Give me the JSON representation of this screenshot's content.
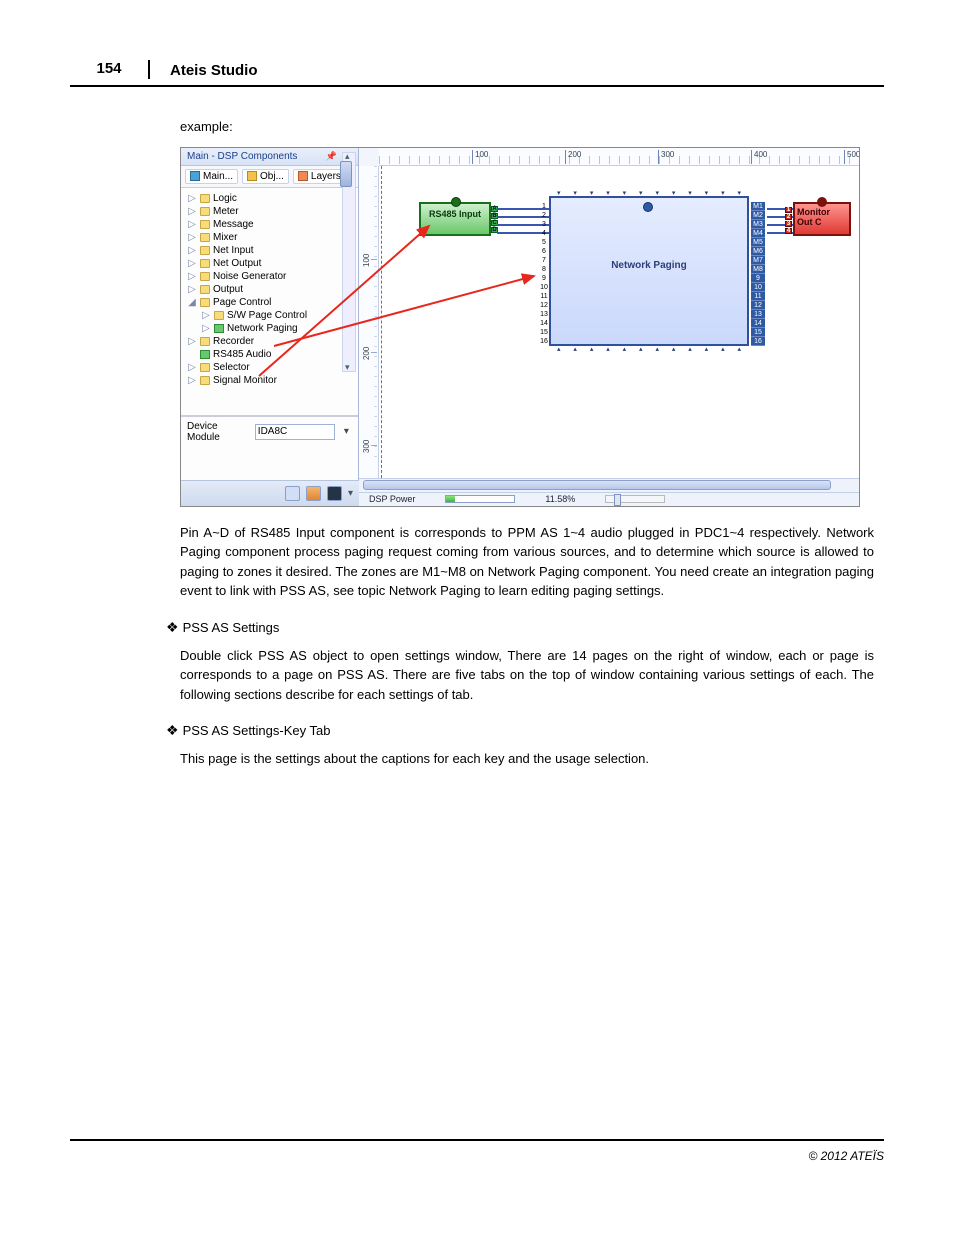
{
  "page": {
    "number": "154",
    "title": "Ateis Studio"
  },
  "text": {
    "example": "example:",
    "para1": "Pin A~D of RS485 Input component is corresponds to PPM AS 1~4 audio plugged in PDC1~4 respectively. Network Paging component process paging request coming from various sources, and to determine which source is allowed to paging to zones it desired. The zones are M1~M8 on Network Paging component. You need create an integration paging event to link with PSS AS, see topic Network Paging to learn editing paging settings.",
    "h1": "PSS AS Settings",
    "para2": "Double click PSS AS object to open settings window, There are 14 pages on the right of window, each or page is corresponds to a page on PSS AS.  There are five tabs on the top of window containing various settings of each. The following sections describe for each settings of tab.",
    "h2": "PSS AS Settings-Key Tab",
    "para3": "This page is the settings about the captions for each key and the usage selection."
  },
  "footer": "© 2012 ATEÏS",
  "ui": {
    "panel_title": "Main - DSP Components",
    "pin_glyph": "📌",
    "close_glyph": "✕",
    "tabs": {
      "main": "Main...",
      "obj": "Obj...",
      "layers": "Layers"
    },
    "tree": [
      {
        "lvl": 0,
        "label": "Logic"
      },
      {
        "lvl": 0,
        "label": "Meter"
      },
      {
        "lvl": 0,
        "label": "Message"
      },
      {
        "lvl": 0,
        "label": "Mixer"
      },
      {
        "lvl": 0,
        "label": "Net Input"
      },
      {
        "lvl": 0,
        "label": "Net Output"
      },
      {
        "lvl": 0,
        "label": "Noise Generator"
      },
      {
        "lvl": 0,
        "label": "Output"
      },
      {
        "lvl": 0,
        "label": "Page Control",
        "open": true
      },
      {
        "lvl": 1,
        "label": "S/W Page Control"
      },
      {
        "lvl": 1,
        "label": "Network Paging",
        "green": true
      },
      {
        "lvl": 0,
        "label": "Recorder"
      },
      {
        "lvl": 0,
        "label": "RS485 Audio",
        "green": true,
        "notw": true
      },
      {
        "lvl": 0,
        "label": "Selector"
      },
      {
        "lvl": 0,
        "label": "Signal Monitor"
      }
    ],
    "device_module_label": "Device Module",
    "device_module_value": "IDA8C",
    "canvas": {
      "ruler_marks": [
        "100",
        "200",
        "300",
        "400",
        "500"
      ],
      "ruler_v": [
        "100",
        "200",
        "300"
      ],
      "rs485_label": "RS485 Input",
      "rs485_pins": [
        "A",
        "B",
        "C",
        "D"
      ],
      "np_title": "Network Paging",
      "np_left_ports": [
        "1",
        "2",
        "3",
        "4",
        "5",
        "6",
        "7",
        "8",
        "9",
        "10",
        "11",
        "12",
        "13",
        "14",
        "15",
        "16"
      ],
      "np_right_ports": [
        "M1",
        "M2",
        "M3",
        "M4",
        "M5",
        "M6",
        "M7",
        "M8",
        "9",
        "10",
        "11",
        "12",
        "13",
        "14",
        "15",
        "16"
      ],
      "monitor_l1": "Monitor",
      "monitor_l2": "Out C",
      "monitor_pins": [
        "1",
        "2",
        "3",
        "4"
      ]
    },
    "status": {
      "label": "DSP Power",
      "percent": "11.58%"
    }
  }
}
